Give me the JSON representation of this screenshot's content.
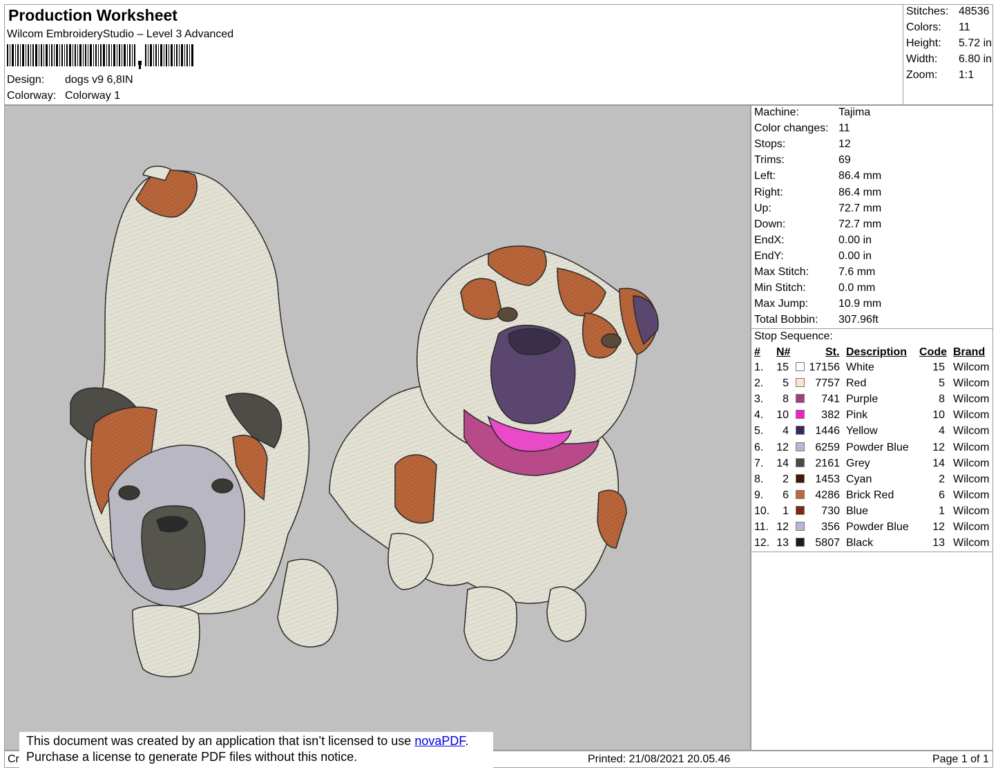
{
  "header": {
    "title": "Production Worksheet",
    "software": "Wilcom EmbroideryStudio – Level 3 Advanced",
    "design_label": "Design:",
    "design_value": "dogs v9 6,8IN",
    "colorway_label": "Colorway:",
    "colorway_value": "Colorway 1"
  },
  "stats": [
    {
      "label": "Stitches:",
      "value": "48536"
    },
    {
      "label": "Colors:",
      "value": "11"
    },
    {
      "label": "Height:",
      "value": "5.72 in"
    },
    {
      "label": "Width:",
      "value": "6.80 in"
    },
    {
      "label": "Zoom:",
      "value": "1:1"
    }
  ],
  "machine_info": [
    {
      "label": "Machine:",
      "value": "Tajima"
    },
    {
      "label": "Color changes:",
      "value": "11"
    },
    {
      "label": "Stops:",
      "value": "12"
    },
    {
      "label": "Trims:",
      "value": "69"
    },
    {
      "label": "Left:",
      "value": "86.4 mm"
    },
    {
      "label": "Right:",
      "value": "86.4 mm"
    },
    {
      "label": "Up:",
      "value": "72.7 mm"
    },
    {
      "label": "Down:",
      "value": "72.7 mm"
    },
    {
      "label": "EndX:",
      "value": "0.00 in"
    },
    {
      "label": "EndY:",
      "value": "0.00 in"
    },
    {
      "label": "Max Stitch:",
      "value": "7.6 mm"
    },
    {
      "label": "Min Stitch:",
      "value": "0.0 mm"
    },
    {
      "label": "Max Jump:",
      "value": "10.9 mm"
    },
    {
      "label": "Total Bobbin:",
      "value": "307.96ft"
    }
  ],
  "stop_sequence": {
    "title": "Stop Sequence:",
    "headers": {
      "num": "#",
      "n": "N#",
      "st": "St.",
      "desc": "Description",
      "code": "Code",
      "brand": "Brand"
    },
    "rows": [
      {
        "num": "1.",
        "n": "15",
        "color": "#ffffff",
        "st": "17156",
        "desc": "White",
        "code": "15",
        "brand": "Wilcom"
      },
      {
        "num": "2.",
        "n": "5",
        "color": "#fde3d6",
        "st": "7757",
        "desc": "Red",
        "code": "5",
        "brand": "Wilcom"
      },
      {
        "num": "3.",
        "n": "8",
        "color": "#a0417e",
        "st": "741",
        "desc": "Purple",
        "code": "8",
        "brand": "Wilcom"
      },
      {
        "num": "4.",
        "n": "10",
        "color": "#f01ed2",
        "st": "382",
        "desc": "Pink",
        "code": "10",
        "brand": "Wilcom"
      },
      {
        "num": "5.",
        "n": "4",
        "color": "#35295a",
        "st": "1446",
        "desc": "Yellow",
        "code": "4",
        "brand": "Wilcom"
      },
      {
        "num": "6.",
        "n": "12",
        "color": "#bab4dc",
        "st": "6259",
        "desc": "Powder Blue",
        "code": "12",
        "brand": "Wilcom"
      },
      {
        "num": "7.",
        "n": "14",
        "color": "#4a4a4a",
        "st": "2161",
        "desc": "Grey",
        "code": "14",
        "brand": "Wilcom"
      },
      {
        "num": "8.",
        "n": "2",
        "color": "#4a150a",
        "st": "1453",
        "desc": "Cyan",
        "code": "2",
        "brand": "Wilcom"
      },
      {
        "num": "9.",
        "n": "6",
        "color": "#c0673a",
        "st": "4286",
        "desc": "Brick Red",
        "code": "6",
        "brand": "Wilcom"
      },
      {
        "num": "10.",
        "n": "1",
        "color": "#7a2a0d",
        "st": "730",
        "desc": "Blue",
        "code": "1",
        "brand": "Wilcom"
      },
      {
        "num": "11.",
        "n": "12",
        "color": "#bab4dc",
        "st": "356",
        "desc": "Powder Blue",
        "code": "12",
        "brand": "Wilcom"
      },
      {
        "num": "12.",
        "n": "13",
        "color": "#1c1c1c",
        "st": "5807",
        "desc": "Black",
        "code": "13",
        "brand": "Wilcom"
      }
    ]
  },
  "footer": {
    "left_fragment": "Cr",
    "printed": "Printed: 21/08/2021 20.05.46",
    "page": "Page 1 of 1"
  },
  "notice": {
    "line1_prefix": "This document was created by an application that isn’t licensed to use ",
    "link": "novaPDF",
    "line1_suffix": ".",
    "line2": "Purchase a license to generate PDF files without this notice."
  },
  "colors": {
    "canvas_bg": "#c0c0c0",
    "thread_white": "#e6e4d8",
    "thread_brown": "#b8653a",
    "thread_purple": "#5b4670",
    "thread_pink": "#e84ac8",
    "thread_grey": "#55554e"
  }
}
